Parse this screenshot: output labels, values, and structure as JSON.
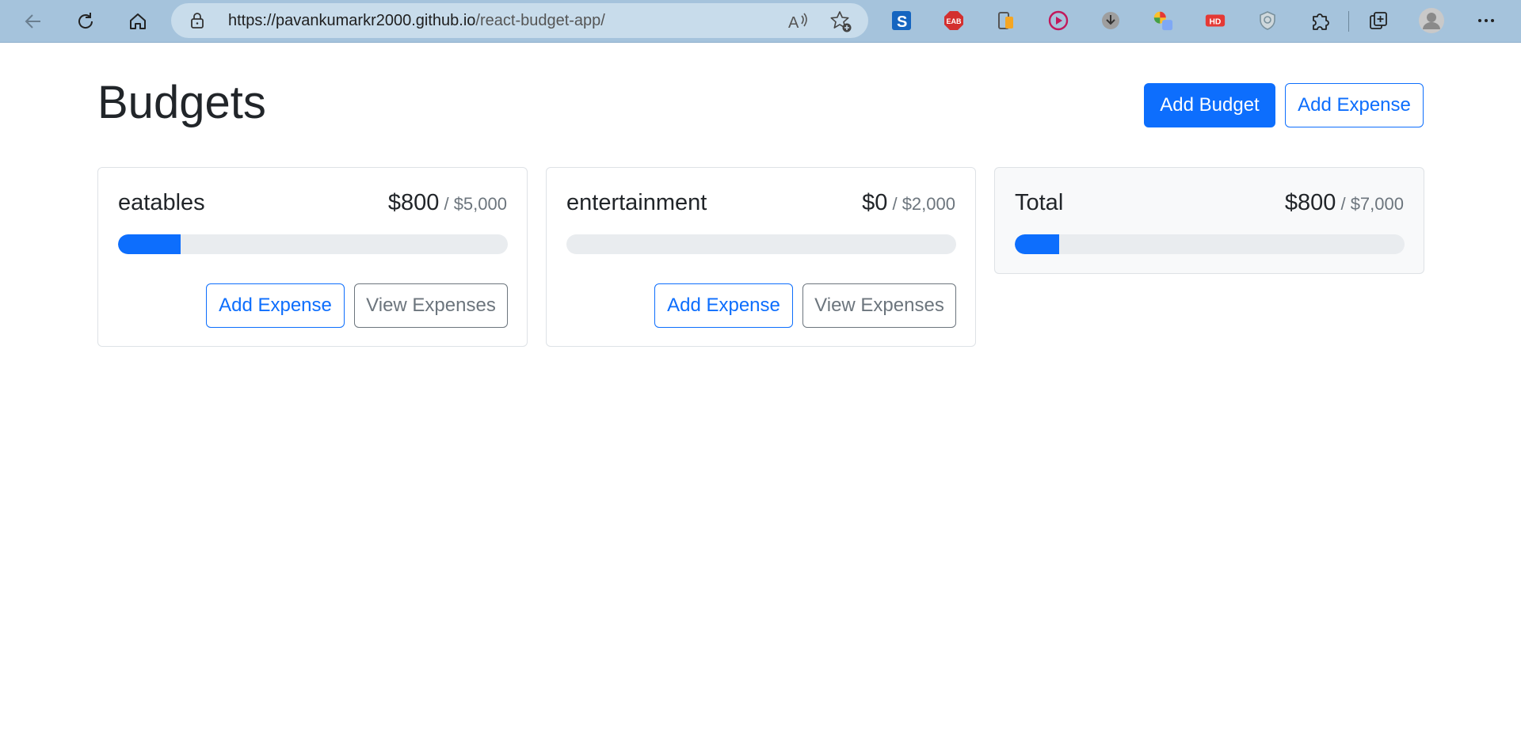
{
  "browser": {
    "url_host": "https://pavankumarkr2000.github.io",
    "url_path": "/react-budget-app/",
    "toolbar_icons": [
      "back-icon",
      "refresh-icon",
      "home-icon",
      "lock-icon",
      "read-aloud-icon",
      "favorite-add-icon"
    ],
    "extensions": [
      "s-extension-icon",
      "eab-extension-icon",
      "phone-extension-icon",
      "play-extension-icon",
      "download-extension-icon",
      "color-extension-icon",
      "hd-extension-icon",
      "shield-extension-icon",
      "extensions-puzzle-icon",
      "collections-icon",
      "profile-avatar",
      "more-menu-icon"
    ]
  },
  "header": {
    "title": "Budgets",
    "add_budget_label": "Add Budget",
    "add_expense_label": "Add Expense"
  },
  "budgets": [
    {
      "name": "eatables",
      "amount": "$800",
      "max": " / $5,000",
      "progress": 0.16,
      "add_expense_label": "Add Expense",
      "view_expenses_label": "View Expenses"
    },
    {
      "name": "entertainment",
      "amount": "$0",
      "max": " / $2,000",
      "progress": 0.0,
      "add_expense_label": "Add Expense",
      "view_expenses_label": "View Expenses"
    }
  ],
  "total": {
    "name": "Total",
    "amount": "$800",
    "max": " / $7,000",
    "progress": 0.114
  },
  "colors": {
    "primary": "#0d6efd",
    "secondary": "#6c757d",
    "track": "#e9ecef",
    "chrome": "#a5c3dc"
  }
}
